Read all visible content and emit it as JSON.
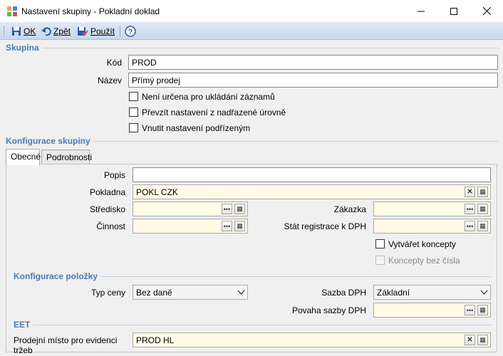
{
  "window": {
    "title": "Nastavení skupiny - Pokladní doklad"
  },
  "toolbar": {
    "ok": "OK",
    "back": "Zpět",
    "apply": "Použít"
  },
  "skupina": {
    "title": "Skupina",
    "kod_label": "Kód",
    "kod_value": "PROD",
    "nazev_label": "Název",
    "nazev_value": "Přímý prodej",
    "chk1": "Není určena pro ukládání záznamů",
    "chk2": "Převzít nastavení z nadřazené úrovně",
    "chk3": "Vnutit nastavení podřízeným"
  },
  "konfigurace": {
    "title": "Konfigurace skupiny",
    "tabs": [
      "Obecné",
      "Podrobnosti"
    ],
    "popis_label": "Popis",
    "popis_value": "",
    "pokladna_label": "Pokladna",
    "pokladna_value": "POKL CZK",
    "stredisko_label": "Středisko",
    "zakazka_label": "Zákazka",
    "cinnost_label": "Činnost",
    "stat_label": "Stát registrace k DPH",
    "vytvaret_label": "Vytvářet koncepty",
    "koncepty_label": "Koncepty bez čísla"
  },
  "polozky": {
    "title": "Konfigurace položky",
    "typ_ceny_label": "Typ ceny",
    "typ_ceny_value": "Bez daně",
    "sazba_label": "Sazba DPH",
    "sazba_value": "Základní",
    "povaha_label": "Povaha sazby DPH"
  },
  "eet": {
    "title": "EET",
    "misto_label": "Prodejní místo pro evidenci tržeb",
    "misto_value": "PROD HL"
  },
  "colors": {
    "section": "#4b79b3",
    "toolbar": "#c9d8ec",
    "required_bg": "#fffbe6"
  }
}
